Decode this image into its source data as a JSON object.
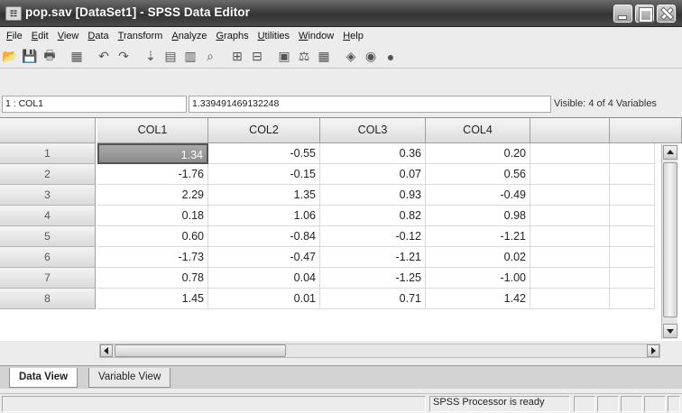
{
  "window": {
    "title": "pop.sav [DataSet1] - SPSS Data Editor"
  },
  "menu": [
    "File",
    "Edit",
    "View",
    "Data",
    "Transform",
    "Analyze",
    "Graphs",
    "Utilities",
    "Window",
    "Help"
  ],
  "toolbar": {
    "icons": [
      "open-icon",
      "save-icon",
      "print-icon",
      "dialog-recall-icon",
      "undo-icon",
      "redo-icon",
      "goto-case-icon",
      "variables-icon",
      "goto-variable-icon",
      "find-icon",
      "insert-cases-icon",
      "insert-variable-icon",
      "split-file-icon",
      "weight-cases-icon",
      "select-cases-icon",
      "value-labels-icon",
      "use-sets-icon",
      "show-all-icon"
    ]
  },
  "editor": {
    "cell_ref": "1 : COL1",
    "cell_value": "1.339491469132248",
    "visible": "Visible: 4 of 4 Variables"
  },
  "grid": {
    "columns": [
      "COL1",
      "COL2",
      "COL3",
      "COL4"
    ],
    "rows": [
      {
        "n": "1",
        "v": [
          "1.34",
          "-0.55",
          "0.36",
          "0.20"
        ]
      },
      {
        "n": "2",
        "v": [
          "-1.76",
          "-0.15",
          "0.07",
          "0.56"
        ]
      },
      {
        "n": "3",
        "v": [
          "2.29",
          "1.35",
          "0.93",
          "-0.49"
        ]
      },
      {
        "n": "4",
        "v": [
          "0.18",
          "1.06",
          "0.82",
          "0.98"
        ]
      },
      {
        "n": "5",
        "v": [
          "0.60",
          "-0.84",
          "-0.12",
          "-1.21"
        ]
      },
      {
        "n": "6",
        "v": [
          "-1.73",
          "-0.47",
          "-1.21",
          "0.02"
        ]
      },
      {
        "n": "7",
        "v": [
          "0.78",
          "0.04",
          "-1.25",
          "-1.00"
        ]
      },
      {
        "n": "8",
        "v": [
          "1.45",
          "0.01",
          "0.71",
          "1.42"
        ]
      }
    ],
    "selected": {
      "row": 0,
      "col": 0
    }
  },
  "tabs": {
    "data_view": "Data View",
    "variable_view": "Variable View"
  },
  "status": {
    "text": "SPSS  Processor is ready"
  }
}
